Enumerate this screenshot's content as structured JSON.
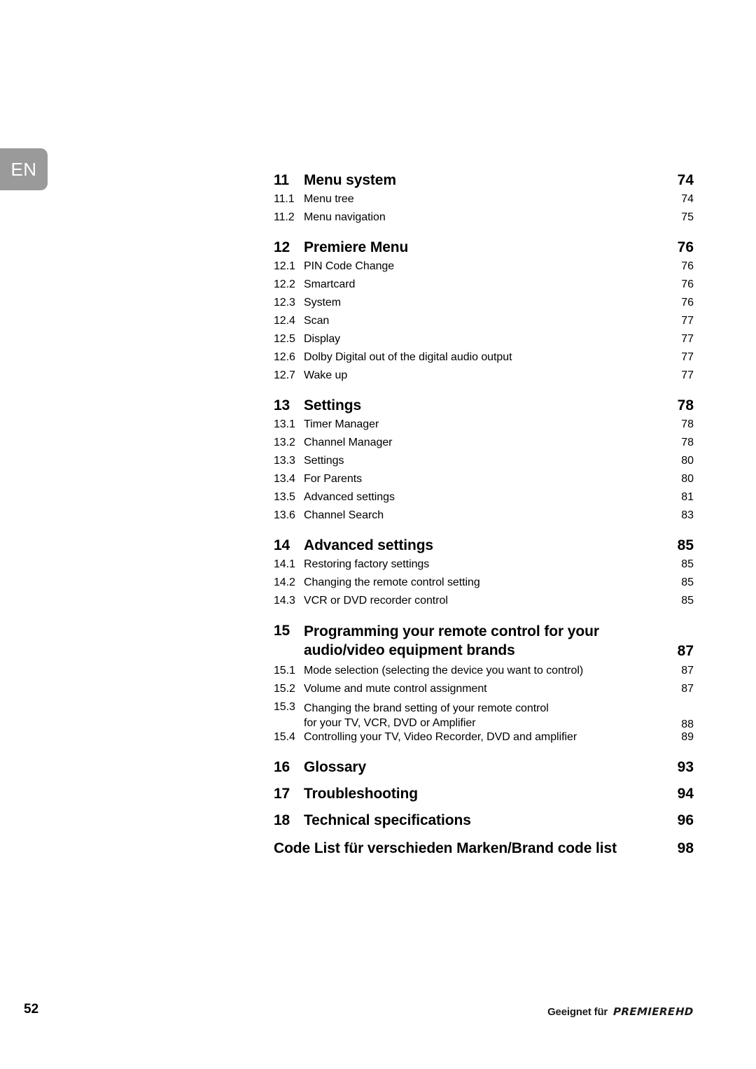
{
  "language_tab": {
    "label": "EN"
  },
  "toc": {
    "entries": [
      {
        "kind": "major",
        "num": "11",
        "title": "Menu system",
        "page": "74"
      },
      {
        "kind": "sub",
        "num": "11.1",
        "title": "Menu tree",
        "page": "74"
      },
      {
        "kind": "sub",
        "num": "11.2",
        "title": "Menu navigation",
        "page": "75"
      },
      {
        "kind": "major",
        "num": "12",
        "title": "Premiere Menu",
        "page": "76"
      },
      {
        "kind": "sub",
        "num": "12.1",
        "title": "PIN Code Change",
        "page": "76"
      },
      {
        "kind": "sub",
        "num": "12.2",
        "title": "Smartcard",
        "page": "76"
      },
      {
        "kind": "sub",
        "num": "12.3",
        "title": "System",
        "page": "76"
      },
      {
        "kind": "sub",
        "num": "12.4",
        "title": "Scan",
        "page": "77"
      },
      {
        "kind": "sub",
        "num": "12.5",
        "title": "Display",
        "page": "77"
      },
      {
        "kind": "sub",
        "num": "12.6",
        "title": "Dolby Digital out of the digital audio output",
        "page": "77"
      },
      {
        "kind": "sub",
        "num": "12.7",
        "title": "Wake up",
        "page": "77"
      },
      {
        "kind": "major",
        "num": "13",
        "title": "Settings",
        "page": "78"
      },
      {
        "kind": "sub",
        "num": "13.1",
        "title": "Timer Manager",
        "page": "78"
      },
      {
        "kind": "sub",
        "num": "13.2",
        "title": "Channel Manager",
        "page": "78"
      },
      {
        "kind": "sub",
        "num": "13.3",
        "title": "Settings",
        "page": "80"
      },
      {
        "kind": "sub",
        "num": "13.4",
        "title": "For Parents",
        "page": "80"
      },
      {
        "kind": "sub",
        "num": "13.5",
        "title": "Advanced settings",
        "page": "81"
      },
      {
        "kind": "sub",
        "num": "13.6",
        "title": "Channel Search",
        "page": "83"
      },
      {
        "kind": "major",
        "num": "14",
        "title": "Advanced settings",
        "page": "85"
      },
      {
        "kind": "sub",
        "num": "14.1",
        "title": "Restoring factory settings",
        "page": "85"
      },
      {
        "kind": "sub",
        "num": "14.2",
        "title": "Changing the remote control setting",
        "page": "85"
      },
      {
        "kind": "sub",
        "num": "14.3",
        "title": "VCR or DVD recorder control",
        "page": "85"
      },
      {
        "kind": "major",
        "num": "15",
        "title_line1": "Programming your remote control for your",
        "title_line2": "audio/video equipment brands",
        "page": "87"
      },
      {
        "kind": "sub",
        "num": "15.1",
        "title": "Mode selection (selecting the device you want to control)",
        "page": "87"
      },
      {
        "kind": "sub",
        "num": "15.2",
        "title": "Volume and mute control assignment",
        "page": "87"
      },
      {
        "kind": "sub",
        "num": "15.3",
        "title_line1": "Changing the brand setting of your remote control",
        "title_line2": "for your TV, VCR, DVD or Amplifier",
        "page": "88"
      },
      {
        "kind": "sub",
        "num": "15.4",
        "title": "Controlling your TV, Video Recorder, DVD and amplifier",
        "page": "89"
      },
      {
        "kind": "major",
        "num": "16",
        "title": "Glossary",
        "page": "93"
      },
      {
        "kind": "major",
        "num": "17",
        "title": "Troubleshooting",
        "page": "94"
      },
      {
        "kind": "major",
        "num": "18",
        "title": "Technical specifications",
        "page": "96"
      },
      {
        "kind": "plain",
        "title": "Code List für verschieden Marken/Brand code list",
        "page": "98"
      }
    ]
  },
  "footer": {
    "page_number": "52",
    "brand_prefix": "Geeignet für",
    "brand_wordmark": "PREMIERE",
    "brand_suffix": "HD"
  }
}
